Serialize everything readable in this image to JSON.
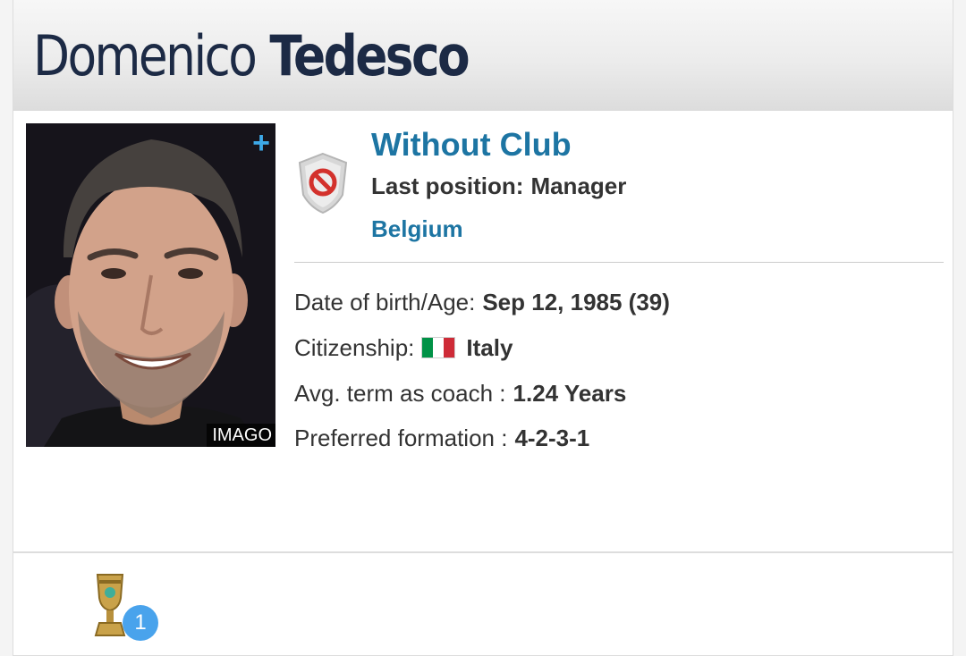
{
  "header": {
    "first_name": "Domenico",
    "last_name": "Tedesco"
  },
  "profile": {
    "photo_credit": "IMAGO",
    "plus_symbol": "+",
    "club_status": "Without Club",
    "last_position_label": "Last position:",
    "last_position_value": "Manager",
    "country_link": "Belgium"
  },
  "details": {
    "dob_label": "Date of birth/Age:",
    "dob_value": "Sep 12, 1985 (39)",
    "citizenship_label": "Citizenship:",
    "citizenship_value": "Italy",
    "term_label": "Avg. term as coach :",
    "term_value": "1.24 Years",
    "formation_label": "Preferred formation :",
    "formation_value": "4-2-3-1"
  },
  "trophies": {
    "count": "1",
    "icon": "cup-trophy-icon"
  },
  "colors": {
    "link_blue": "#1d75a3",
    "name_navy": "#1c2a45",
    "badge_blue": "#49a3ec",
    "flag_green": "#009246",
    "flag_white": "#ffffff",
    "flag_red": "#ce2b37"
  },
  "icons": {
    "club": "no-club-shield-icon",
    "flag": "italy-flag-icon",
    "expand": "plus-icon"
  }
}
